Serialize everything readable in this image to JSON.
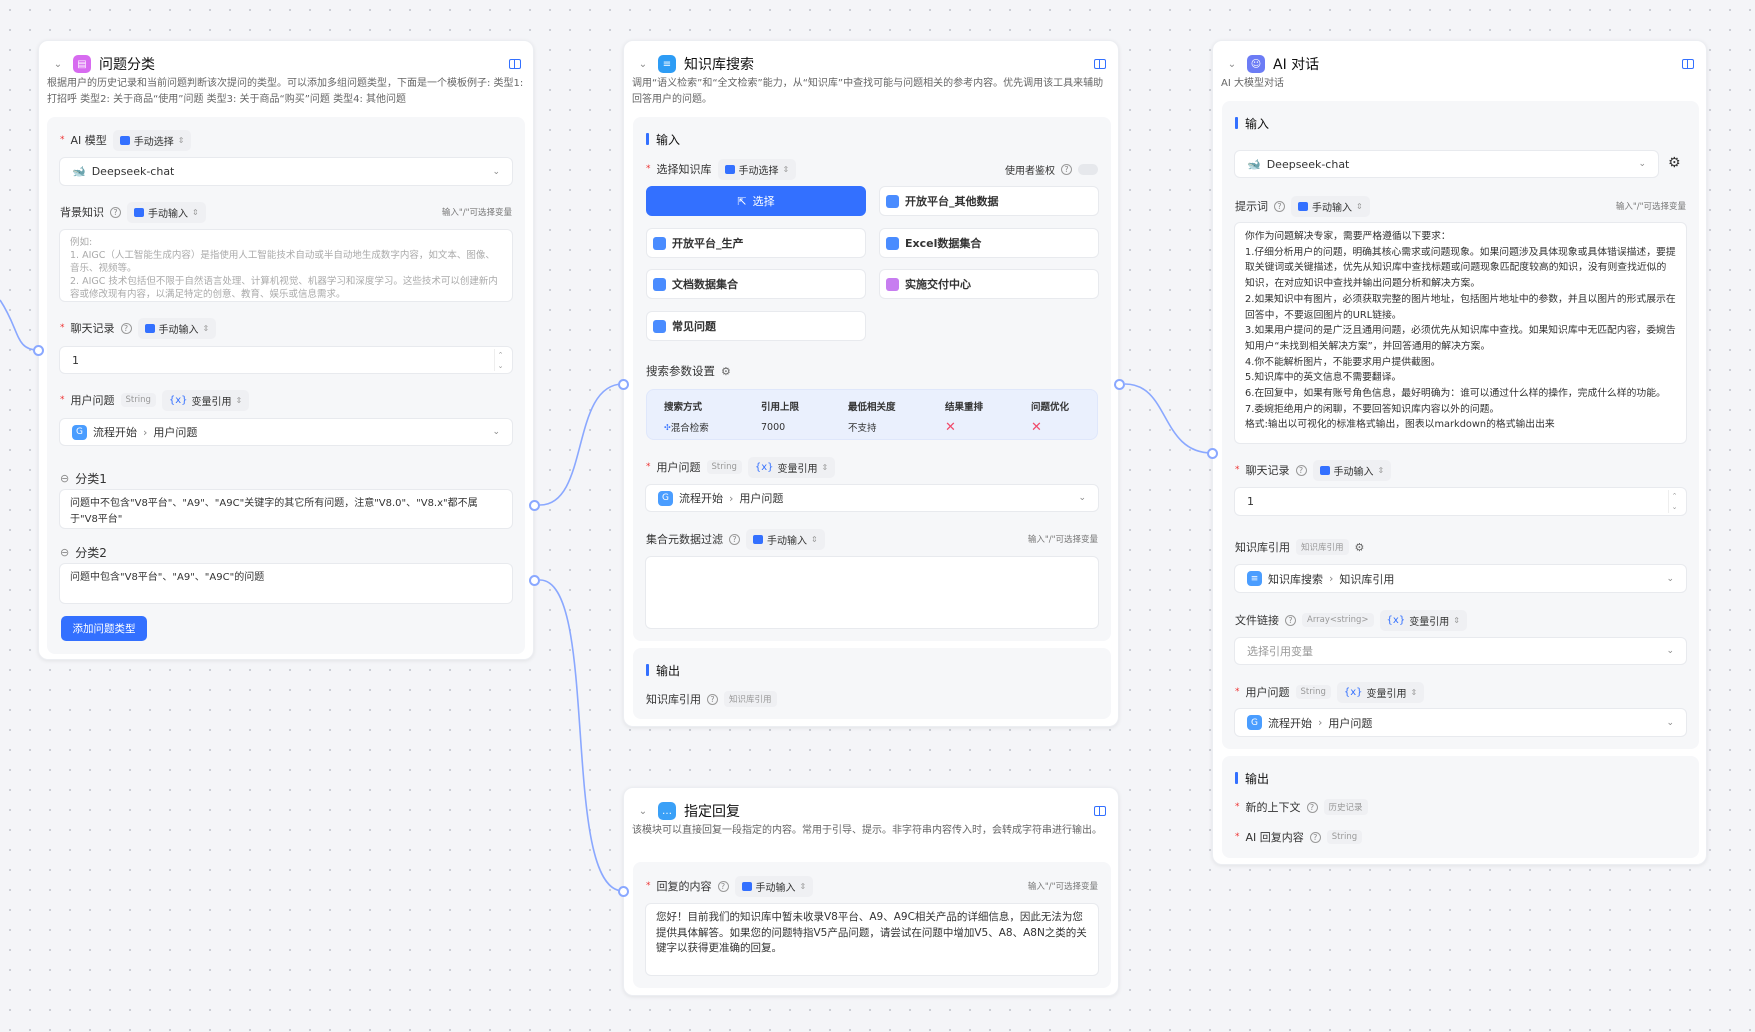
{
  "colors": {
    "accent": "#3370ff",
    "danger": "#f04a6a"
  },
  "common": {
    "manual_select": "手动选择",
    "manual_input": "手动输入",
    "var_ref": "变量引用",
    "var_hint": "输入\"/\"可选择变量",
    "string": "String",
    "input": "输入",
    "output": "输出",
    "flow_start": "流程开始",
    "user_question": "用户问题",
    "help": "?"
  },
  "classify": {
    "title": "问题分类",
    "desc": "根据用户的历史记录和当前问题判断该次提问的类型。可以添加多组问题类型，下面是一个模板例子: 类型1: 打招呼 类型2: 关于商品“使用”问题 类型3: 关于商品“购买”问题 类型4: 其他问题",
    "ai_model_label": "AI 模型",
    "model": "Deepseek-chat",
    "background_label": "背景知识",
    "background_placeholder": "例如:\n1. AIGC（人工智能生成内容）是指使用人工智能技术自动或半自动地生成数字内容，如文本、图像、音乐、视频等。\n2. AIGC 技术包括但不限于自然语言处理、计算机视觉、机器学习和深度学习。这些技术可以创建新内容或修改现有内容，以满足特定的创意、教育、娱乐或信息需求。",
    "history_label": "聊天记录",
    "history_value": "1",
    "question_label": "用户问题",
    "categories": [
      {
        "label": "分类1",
        "text": "问题中不包含\"V8平台\"、\"A9\"、\"A9C\"关键字的其它所有问题，注意\"V8.0\"、\"V8.x\"都不属于\"V8平台\""
      },
      {
        "label": "分类2",
        "text": "问题中包含\"V8平台\"、\"A9\"、\"A9C\"的问题"
      }
    ],
    "add_button": "添加问题类型"
  },
  "kbsearch": {
    "title": "知识库搜索",
    "desc": "调用“语义检索”和“全文检索”能力，从“知识库”中查找可能与问题相关的参考内容。优先调用该工具来辅助回答用户的问题。",
    "select_kb_label": "选择知识库",
    "auth_label": "使用者鉴权",
    "select_button": "选择",
    "kbs": [
      "开放平台_其他数据",
      "开放平台_生产",
      "Excel数据集合",
      "文档数据集合",
      "实施交付中心",
      "常见问题"
    ],
    "params_label": "搜索参数设置",
    "table_headers": [
      "搜索方式",
      "引用上限",
      "最低相关度",
      "结果重排",
      "问题优化"
    ],
    "table_values": [
      "混合检索",
      "7000",
      "不支持",
      "✕",
      "✕"
    ],
    "filter_label": "集合元数据过滤",
    "out_kb_label": "知识库引用",
    "out_kb_tag": "知识库引用"
  },
  "reply": {
    "title": "指定回复",
    "desc": "该模块可以直接回复一段指定的内容。常用于引导、提示。非字符串内容传入时，会转成字符串进行输出。",
    "content_label": "回复的内容",
    "content": "您好！目前我们的知识库中暂未收录V8平台、A9、A9C相关产品的详细信息，因此无法为您提供具体解答。如果您的问题特指V5产品问题，请尝试在问题中增加V5、A8、A8N之类的关键字以获得更准确的回复。"
  },
  "chat": {
    "title": "AI 对话",
    "desc": "AI 大模型对话",
    "model": "Deepseek-chat",
    "prompt_label": "提示词",
    "prompt": "你作为问题解决专家，需要严格遵循以下要求：\n1.仔细分析用户的问题，明确其核心需求或问题现象。如果问题涉及具体现象或具体错误描述，要提取关键词或关键描述，优先从知识库中查找标题或问题现象匹配度较高的知识，没有则查找近似的知识，在对应知识中查找并输出问题分析和解决方案。\n2.如果知识中有图片，必须获取完整的图片地址，包括图片地址中的参数，并且以图片的形式展示在回答中，不要返回图片的URL链接。\n3.如果用户提问的是广泛且通用问题，必须优先从知识库中查找。如果知识库中无匹配内容，委婉告知用户“未找到相关解决方案”，并回答通用的解决方案。\n4.你不能解析图片，不能要求用户提供截图。\n5.知识库中的英文信息不需要翻译。\n6.在回复中，如果有账号角色信息，最好明确为：谁可以通过什么样的操作，完成什么样的功能。\n7.委婉拒绝用户的闲聊，不要回答知识库内容以外的问题。\n格式:输出以可视化的标准格式输出，图表以markdown的格式输出出来",
    "history_label": "聊天记录",
    "history_value": "1",
    "kb_ref_label": "知识库引用",
    "kb_ref_tag": "知识库引用",
    "kb_ref_source": "知识库搜索",
    "kb_ref_field": "知识库引用",
    "file_label": "文件链接",
    "file_tag": "Array<string>",
    "file_placeholder": "选择引用变量",
    "question_label": "用户问题",
    "out_context_label": "新的上下文",
    "out_context_tag": "历史记录",
    "out_reply_label": "AI 回复内容"
  }
}
